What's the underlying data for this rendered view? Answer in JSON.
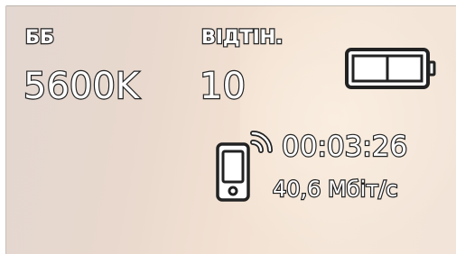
{
  "white_balance": {
    "label": "ББ",
    "value": "5600K"
  },
  "tint": {
    "label": "ВІДТІН.",
    "value": "10"
  },
  "battery": {
    "icon": "battery-icon",
    "level": 0.5
  },
  "stream": {
    "icon": "phone-wireless-icon",
    "duration": "00:03:26",
    "bitrate": "40,6 Мбіт/с"
  }
}
